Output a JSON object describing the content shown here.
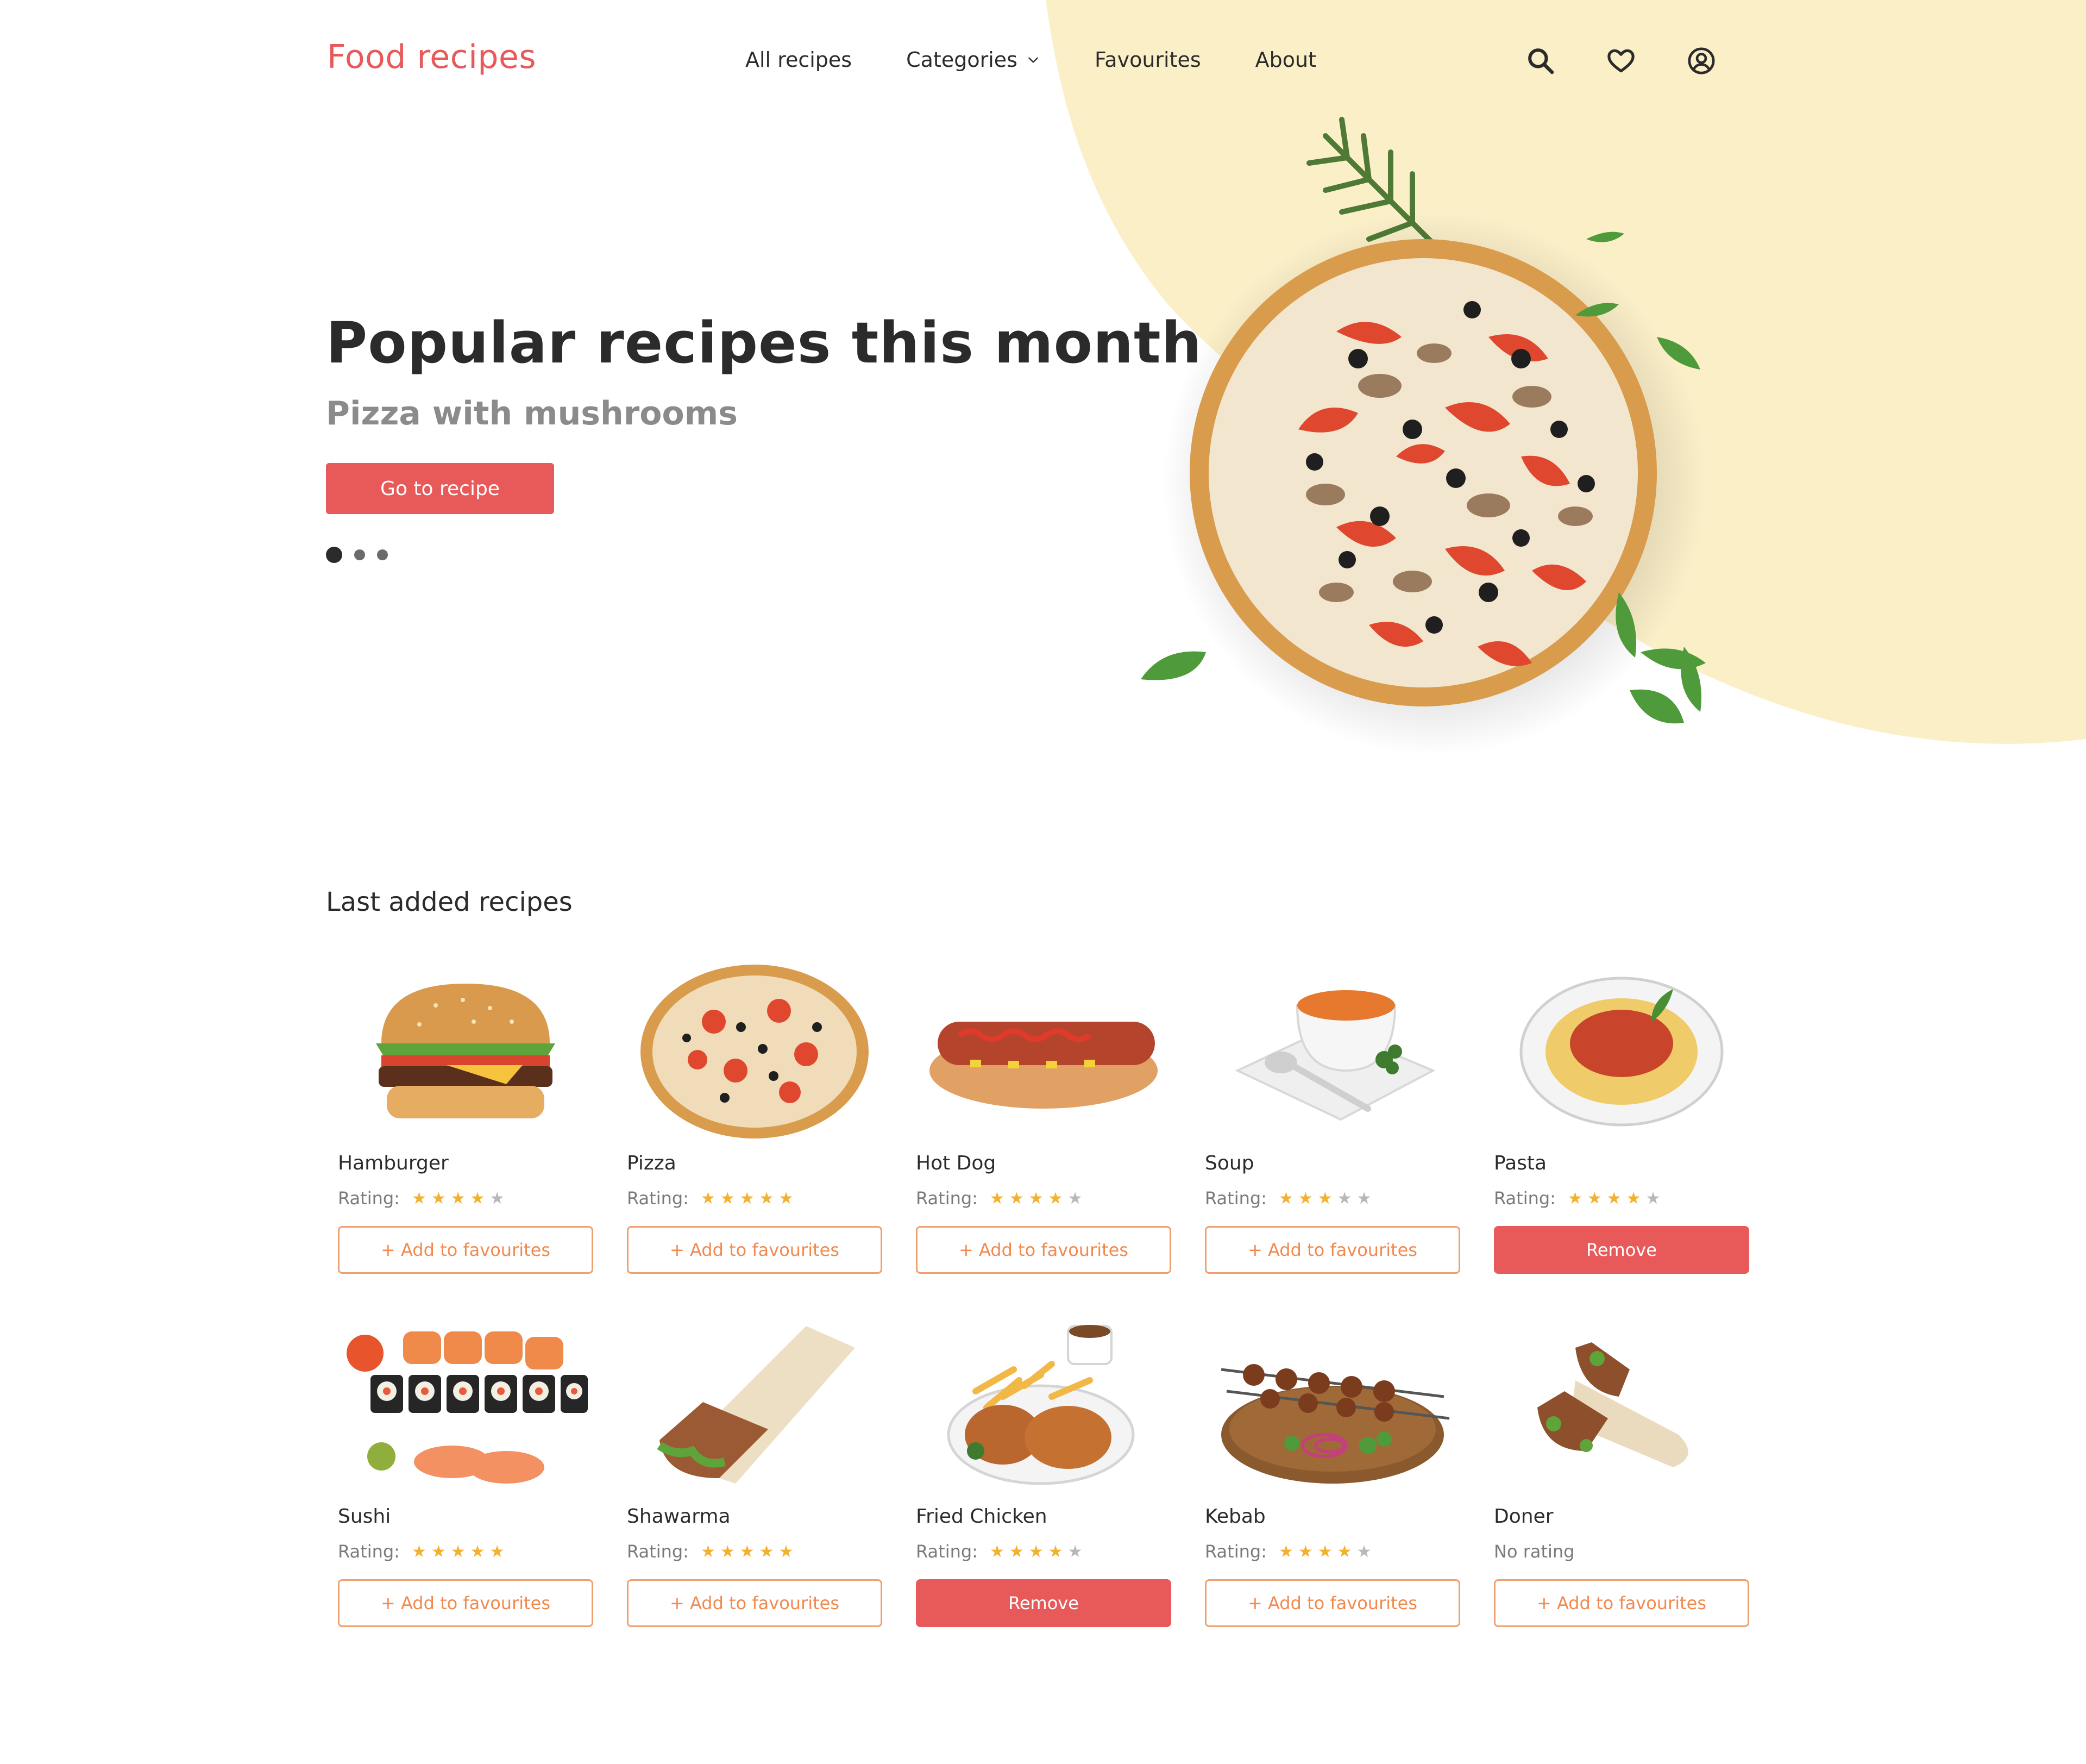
{
  "header": {
    "logo": "Food recipes",
    "nav": {
      "all_recipes": "All recipes",
      "categories": "Categories",
      "favourites": "Favourites",
      "about": "About"
    },
    "icons": [
      "search-icon",
      "heart-icon",
      "user-icon"
    ]
  },
  "hero": {
    "title": "Popular recipes this month",
    "subtitle": "Pizza with mushrooms",
    "button": "Go to recipe",
    "slides": 3,
    "active_slide": 1,
    "background_color": "#fbefc8"
  },
  "section": {
    "title": "Last added recipes",
    "rating_label": "Rating:",
    "no_rating_label": "No rating",
    "add_label": "+ Add to favourites",
    "remove_label": "Remove"
  },
  "colors": {
    "accent": "#e85a5a",
    "add_outline": "#f0a070",
    "star": "#f2b12f"
  },
  "recipes": [
    {
      "name": "Hamburger",
      "rating": 4,
      "favourite": false
    },
    {
      "name": "Pizza",
      "rating": 5,
      "favourite": false
    },
    {
      "name": "Hot Dog",
      "rating": 4,
      "favourite": false
    },
    {
      "name": "Soup",
      "rating": 3,
      "favourite": false
    },
    {
      "name": "Pasta",
      "rating": 4,
      "favourite": true
    },
    {
      "name": "Sushi",
      "rating": 5,
      "favourite": false
    },
    {
      "name": "Shawarma",
      "rating": 5,
      "favourite": false
    },
    {
      "name": "Fried Chicken",
      "rating": 4,
      "favourite": true
    },
    {
      "name": "Kebab",
      "rating": 4,
      "favourite": false
    },
    {
      "name": "Doner",
      "rating": null,
      "favourite": false
    }
  ]
}
